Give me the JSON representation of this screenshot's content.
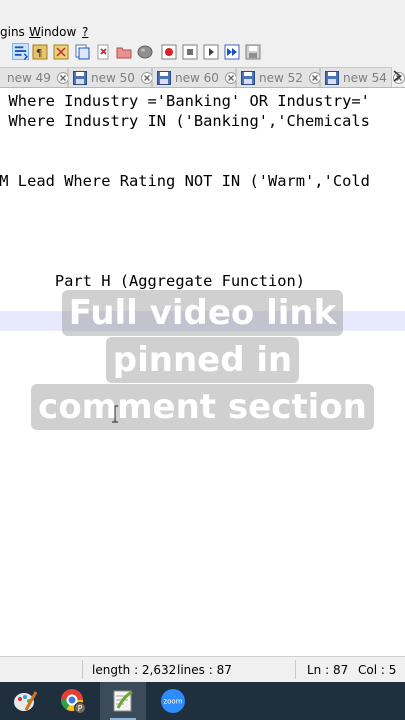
{
  "menubar": {
    "items": [
      "gins",
      "Window",
      "?"
    ],
    "accelerators": [
      "",
      "W",
      "?"
    ]
  },
  "toolbar": {
    "icons": [
      "word-wrap-icon",
      "show-all-chars-icon",
      "indent-guide-icon",
      "define-language-icon",
      "document-map-icon",
      "function-list-icon",
      "folder-workspace-icon",
      "monitoring-icon",
      "record-macro-icon",
      "stop-recording-icon",
      "play-macro-icon",
      "run-macro-multiple-icon",
      "save-macro-icon"
    ]
  },
  "tabs": [
    {
      "label": "new 49"
    },
    {
      "label": "new 50"
    },
    {
      "label": "new 60"
    },
    {
      "label": "new 52"
    },
    {
      "label": "new 54"
    }
  ],
  "editor": {
    "lines": [
      {
        "text": "e Where Industry ='Banking' OR Industry='"
      },
      {
        "text": "e Where Industry IN ('Banking','Chemicals"
      },
      {
        "text": "OM Lead Where Rating NOT IN ('Warm','Cold"
      },
      {
        "text": "       Part H (Aggregate Function)"
      }
    ]
  },
  "overlay": {
    "lines": [
      "Full video link",
      "pinned in",
      "comment section"
    ]
  },
  "status": {
    "length": "length : 2,632",
    "lines": "lines : 87",
    "ln": "Ln : 87",
    "col": "Col : 5"
  },
  "taskbar": {
    "items": [
      "paint-icon",
      "chrome-profile-icon",
      "notepad-plus-plus-icon",
      "zoom-icon"
    ],
    "zoom_label": "zoom",
    "chrome_badge": "P"
  },
  "colors": {
    "chrome_bg": "#f0f0f0",
    "current_line": "#e8e8ff",
    "taskbar": "#1f2f3d",
    "zoom_blue": "#2d8cff"
  }
}
